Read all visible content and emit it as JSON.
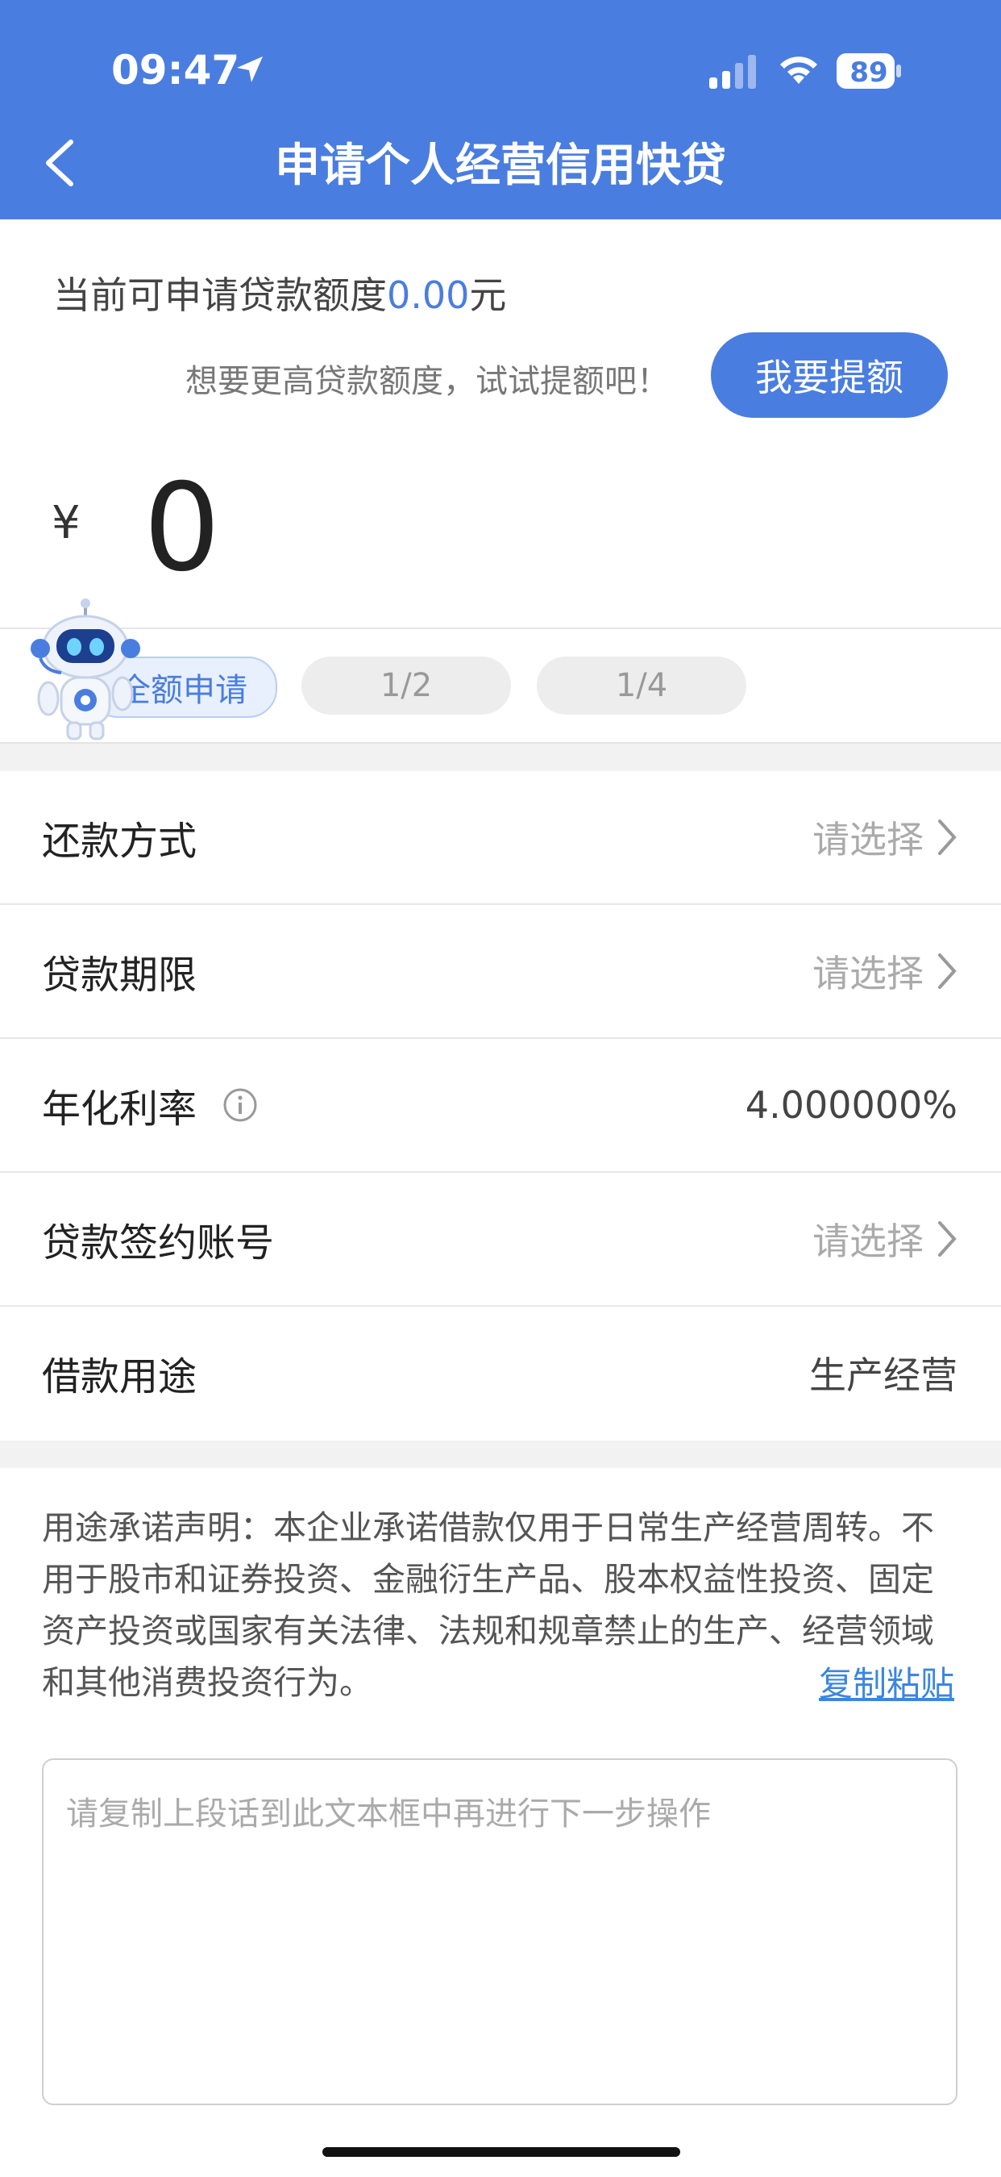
{
  "status_bar": {
    "time": "09:47",
    "battery": "89"
  },
  "header": {
    "title": "申请个人经营信用快贷"
  },
  "quota": {
    "prefix": "当前可申请贷款额度",
    "amount": "0.00",
    "unit": "元"
  },
  "raise": {
    "hint": "想要更高贷款额度，试试提额吧！",
    "button": "我要提额"
  },
  "loan_amount": {
    "currency": "¥",
    "value": "0"
  },
  "quick_options": [
    "全额申请",
    "1/2",
    "1/4"
  ],
  "rows": [
    {
      "label": "还款方式",
      "value": "请选择"
    },
    {
      "label": "贷款期限",
      "value": "请选择"
    },
    {
      "label": "年化利率",
      "value": "4.000000%"
    },
    {
      "label": "贷款签约账号",
      "value": "请选择"
    },
    {
      "label": "借款用途",
      "value": "生产经营"
    }
  ],
  "statement": {
    "text": "用途承诺声明：本企业承诺借款仅用于日常生产经营周转。不用于股市和证券投资、金融衍生产品、股本权益性投资、固定资产投资或国家有关法律、法规和规章禁止的生产、经营领域和其他消费投资行为。",
    "copy_link": "复制粘贴"
  },
  "input": {
    "placeholder": "请复制上段话到此文本框中再进行下一步操作"
  },
  "colors": {
    "primary": "#4a7de0",
    "link": "#3b86e0"
  }
}
